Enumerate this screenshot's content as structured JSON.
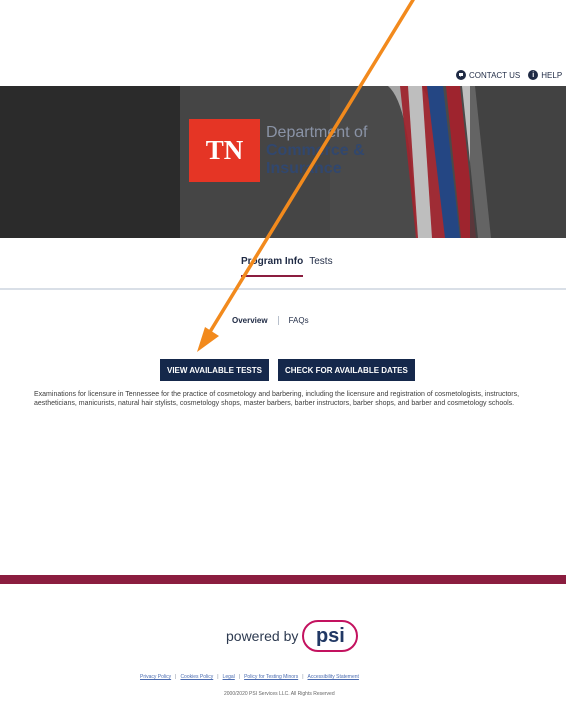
{
  "header": {
    "contact_label": "CONTACT US",
    "help_label": "HELP"
  },
  "hero": {
    "logo_text": "TN",
    "department_line_1": "Department of",
    "department_line_2": "Commerce &",
    "department_line_3": "Insurance"
  },
  "tabs": {
    "program_info": "Program Info",
    "tests": "Tests"
  },
  "subnav": {
    "overview": "Overview",
    "faqs": "FAQs"
  },
  "actions": {
    "view_tests": "VIEW AVAILABLE TESTS",
    "check_dates": "CHECK FOR AVAILABLE DATES"
  },
  "description": "Examinations for licensure in Tennessee for the practice of cosmetology and barbering, including the licensure and registration of cosmetologists, instructors, aestheticians, manicurists, natural hair stylists, cosmetology shops, master barbers, barber instructors, barber shops, and barber and cosmetology schools.",
  "footer": {
    "powered_by": "powered by",
    "logo_text": "psi",
    "links": [
      "Privacy Policy",
      "Cookies Policy",
      "Legal",
      "Policy for Testing Minors",
      "Accessibility Statement"
    ],
    "copyright": "2000/2020 PSI Services LLC. All Rights Reserved"
  },
  "icons": {
    "contact": "chat-bubble-icon",
    "help": "info-icon",
    "arrow": "annotation-arrow-icon"
  },
  "colors": {
    "navy": "#15284b",
    "maroon": "#8b1d3f",
    "tn_red": "#e53525",
    "annotation_orange": "#f28a1d"
  }
}
